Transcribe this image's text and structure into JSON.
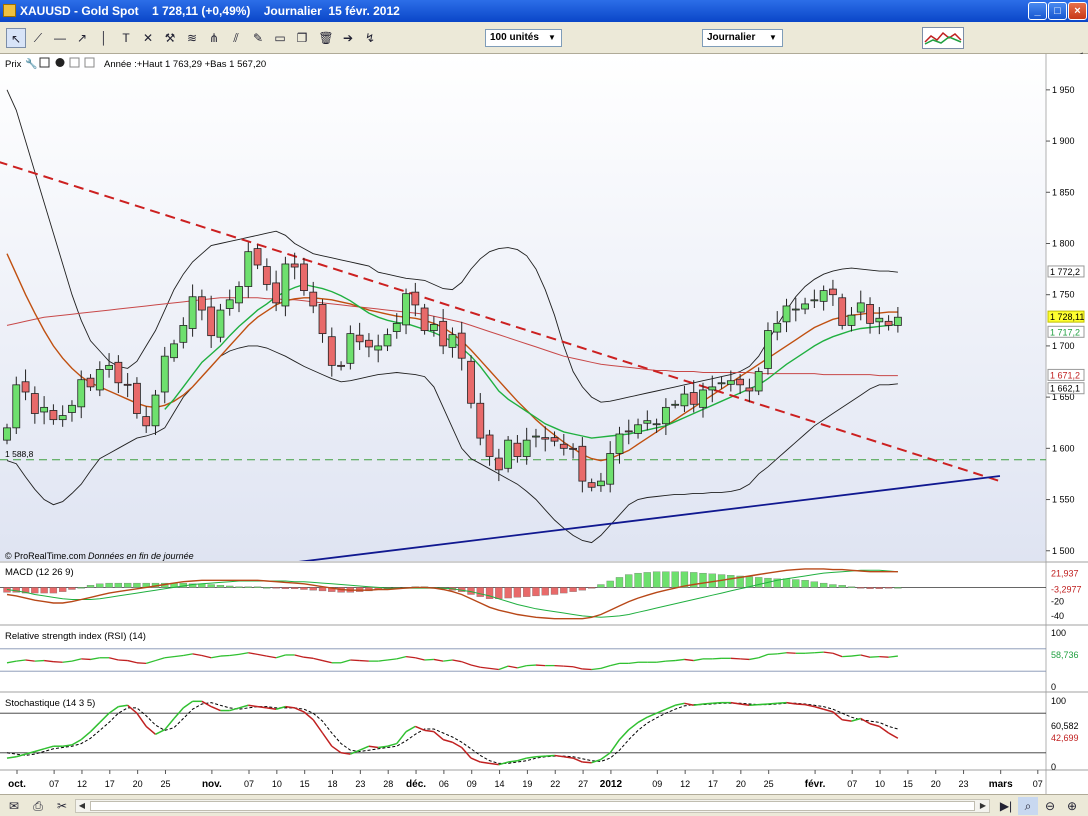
{
  "window": {
    "title": "XAUUSD - Gold Spot    1 728,11 (+0,49%)    Journalier  15 févr. 2012",
    "buttons": [
      "_",
      "□",
      "×"
    ]
  },
  "toolbar": {
    "icons": [
      "cursor-icon",
      "line-icon",
      "h-line-icon",
      "trend-line-icon",
      "v-line-icon",
      "text-icon",
      "cross-icon",
      "tools-icon",
      "fibonacci-icon",
      "pitchfork-icon",
      "edit-icon",
      "rectangle-icon",
      "copy-icon",
      "trash-icon",
      "arrow-right-icon",
      "indicator-icon"
    ],
    "units_select": "100 unités",
    "period_select": "Journalier"
  },
  "panels": {
    "price": {
      "label": "Prix",
      "info": "Année :+Haut 1 763,29 +Bas 1 567,20"
    },
    "macd": {
      "label": "MACD (12 26 9)"
    },
    "rsi": {
      "label": "Relative strength index (RSI) (14)"
    },
    "stoch": {
      "label": "Stochastique (14 3 5)"
    }
  },
  "watermark": {
    "brand": "© ProRealTime.com",
    "note": "Données en fin de journée"
  },
  "colors": {
    "up": "#6ee06e",
    "down": "#e86a6a",
    "background_top": "#ffffff",
    "background_bottom": "#dfe4f2",
    "resistance": "#cc2020",
    "support": "#101890",
    "bollinger": "#202020",
    "ma_short": "#20b040",
    "ma_long": "#c84848"
  },
  "chart_data": {
    "type": "candlestick",
    "price_axis": {
      "ticks": [
        "1 950",
        "1 900",
        "1 850",
        "1 800",
        "1 750",
        "1 700",
        "1 650",
        "1 600",
        "1 550",
        "1 500"
      ],
      "ylim": [
        1490,
        1985
      ]
    },
    "price_labels": [
      {
        "text": "1 772,2",
        "value": 1772.2,
        "color": "#000000",
        "bg": "#ffffff"
      },
      {
        "text": "1 728,11",
        "value": 1728.11,
        "color": "#000000",
        "bg": "#ffff30"
      },
      {
        "text": "1 717,2",
        "value": 1717.2,
        "color": "#20a040",
        "bg": "#ffffff"
      },
      {
        "text": "1 671,2",
        "value": 1671.2,
        "color": "#c02020",
        "bg": "#ffffff"
      },
      {
        "text": "1 662,1",
        "value": 1662.1,
        "color": "#000000",
        "bg": "#ffffff"
      }
    ],
    "support_label": {
      "text": "1 588,8",
      "value": 1588.8
    },
    "x_labels": [
      {
        "text": "oct.",
        "i": 0,
        "bold": true
      },
      {
        "text": "07",
        "i": 4
      },
      {
        "text": "12",
        "i": 7
      },
      {
        "text": "17",
        "i": 10
      },
      {
        "text": "20",
        "i": 13
      },
      {
        "text": "25",
        "i": 16
      },
      {
        "text": "nov.",
        "i": 21,
        "bold": true
      },
      {
        "text": "07",
        "i": 25
      },
      {
        "text": "10",
        "i": 28
      },
      {
        "text": "15",
        "i": 31
      },
      {
        "text": "18",
        "i": 34
      },
      {
        "text": "23",
        "i": 37
      },
      {
        "text": "28",
        "i": 40
      },
      {
        "text": "déc.",
        "i": 43,
        "bold": true
      },
      {
        "text": "06",
        "i": 46
      },
      {
        "text": "09",
        "i": 49
      },
      {
        "text": "14",
        "i": 52
      },
      {
        "text": "19",
        "i": 55
      },
      {
        "text": "22",
        "i": 58
      },
      {
        "text": "27",
        "i": 61
      },
      {
        "text": "2012",
        "i": 64,
        "bold": true
      },
      {
        "text": "09",
        "i": 69
      },
      {
        "text": "12",
        "i": 72
      },
      {
        "text": "17",
        "i": 75
      },
      {
        "text": "20",
        "i": 78
      },
      {
        "text": "25",
        "i": 81
      },
      {
        "text": "févr.",
        "i": 86,
        "bold": true
      },
      {
        "text": "07",
        "i": 90
      },
      {
        "text": "10",
        "i": 93
      },
      {
        "text": "15",
        "i": 96
      },
      {
        "text": "20",
        "i": 99
      },
      {
        "text": "23",
        "i": 102
      },
      {
        "text": "mars",
        "i": 106,
        "bold": true
      },
      {
        "text": "07",
        "i": 110
      }
    ],
    "closes": [
      1620,
      1662,
      1655,
      1634,
      1640,
      1628,
      1632,
      1642,
      1667,
      1660,
      1677,
      1681,
      1664,
      1662,
      1634,
      1622,
      1652,
      1690,
      1702,
      1720,
      1748,
      1735,
      1710,
      1735,
      1745,
      1758,
      1792,
      1779,
      1760,
      1742,
      1780,
      1777,
      1754,
      1739,
      1712,
      1681,
      1680,
      1712,
      1704,
      1699,
      1700,
      1711,
      1722,
      1751,
      1740,
      1715,
      1721,
      1700,
      1711,
      1688,
      1644,
      1610,
      1592,
      1579,
      1608,
      1592,
      1608,
      1612,
      1609,
      1607,
      1600,
      1599,
      1568,
      1562,
      1568,
      1595,
      1614,
      1616,
      1623,
      1627,
      1624,
      1640,
      1643,
      1653,
      1643,
      1657,
      1660,
      1664,
      1666,
      1662,
      1656,
      1675,
      1715,
      1722,
      1739,
      1736,
      1741,
      1745,
      1754,
      1750,
      1720,
      1730,
      1742,
      1722,
      1727,
      1720,
      1728
    ],
    "ma_short": [
      null,
      null,
      null,
      null,
      null,
      null,
      null,
      null,
      null,
      null,
      null,
      null,
      null,
      null,
      null,
      null,
      null,
      1638,
      1648,
      1660,
      1672,
      1684,
      1692,
      1700,
      1710,
      1719,
      1727,
      1735,
      1741,
      1748,
      1753,
      1757,
      1760,
      1758,
      1756,
      1753,
      1749,
      1744,
      1738,
      1732,
      1728,
      1725,
      1723,
      1722,
      1719,
      1716,
      1713,
      1709,
      1704,
      1698,
      1690,
      1680,
      1668,
      1656,
      1648,
      1642,
      1636,
      1630,
      1624,
      1620,
      1616,
      1614,
      1612,
      1610,
      1611,
      1612,
      1613,
      1614,
      1616,
      1618,
      1620,
      1622,
      1626,
      1630,
      1634,
      1638,
      1642,
      1646,
      1650,
      1654,
      1658,
      1662,
      1668,
      1675,
      1682,
      1688,
      1694,
      1700,
      1705,
      1709,
      1712,
      1715,
      1717,
      1718,
      1719,
      1720,
      1721
    ],
    "ma_long": [
      1720,
      1722,
      1724,
      1726,
      1728,
      1729,
      1730,
      1731,
      1732,
      1733,
      1734,
      1735,
      1736,
      1737,
      1738,
      1739,
      1740,
      1741,
      1742,
      1743,
      1744,
      1745,
      1746,
      1747,
      1747,
      1747,
      1747,
      1747,
      1746,
      1746,
      1745,
      1745,
      1744,
      1743,
      1742,
      1741,
      1740,
      1739,
      1738,
      1737,
      1736,
      1735,
      1734,
      1733,
      1732,
      1731,
      1729,
      1727,
      1725,
      1723,
      1720,
      1717,
      1714,
      1711,
      1708,
      1705,
      1702,
      1699,
      1696,
      1693,
      1690,
      1688,
      1686,
      1684,
      1682,
      1681,
      1680,
      1679,
      1678,
      1677,
      1676,
      1676,
      1675,
      1675,
      1675,
      1674,
      1674,
      1674,
      1674,
      1674,
      1674,
      1673,
      1673,
      1673,
      1673,
      1673,
      1673,
      1673,
      1672,
      1672,
      1672,
      1672,
      1672,
      1672,
      1671,
      1671,
      1671
    ],
    "ma_slow": [
      1790,
      1770,
      1750,
      1732,
      1715,
      1700,
      1688,
      1678,
      1670,
      1664,
      1660,
      1656,
      1652,
      1648,
      1644,
      1641,
      1640,
      1642,
      1646,
      1652,
      1660,
      1670,
      1680,
      1690,
      1700,
      1710,
      1720,
      1728,
      1734,
      1740,
      1744,
      1746,
      1747,
      1747,
      1746,
      1745,
      1743,
      1741,
      1738,
      1735,
      1733,
      1731,
      1729,
      1728,
      1727,
      1725,
      1722,
      1718,
      1712,
      1705,
      1696,
      1686,
      1676,
      1666,
      1656,
      1646,
      1637,
      1628,
      1620,
      1613,
      1606,
      1600,
      1594,
      1590,
      1588,
      1590,
      1594,
      1598,
      1604,
      1610,
      1616,
      1622,
      1628,
      1634,
      1640,
      1646,
      1652,
      1658,
      1664,
      1670,
      1676,
      1682,
      1688,
      1694,
      1700,
      1706,
      1712,
      1718,
      1722,
      1726,
      1728,
      1730,
      1731,
      1732,
      1732,
      1733,
      1733
    ],
    "bollinger_upper": [
      1950,
      1930,
      1900,
      1870,
      1840,
      1810,
      1780,
      1750,
      1725,
      1705,
      1695,
      1685,
      1680,
      1678,
      1685,
      1700,
      1715,
      1735,
      1755,
      1770,
      1782,
      1790,
      1798,
      1800,
      1802,
      1804,
      1806,
      1808,
      1810,
      1812,
      1808,
      1800,
      1795,
      1790,
      1788,
      1786,
      1784,
      1782,
      1780,
      1778,
      1772,
      1770,
      1768,
      1766,
      1765,
      1764,
      1760,
      1756,
      1755,
      1762,
      1775,
      1785,
      1792,
      1795,
      1796,
      1794,
      1788,
      1775,
      1755,
      1730,
      1700,
      1675,
      1660,
      1650,
      1645,
      1646,
      1648,
      1650,
      1652,
      1654,
      1656,
      1658,
      1660,
      1662,
      1664,
      1666,
      1668,
      1670,
      1672,
      1675,
      1680,
      1690,
      1705,
      1720,
      1735,
      1748,
      1758,
      1765,
      1770,
      1773,
      1775,
      1776,
      1775,
      1774,
      1773,
      1773,
      1772
    ],
    "bollinger_lower": [
      1588,
      1585,
      1572,
      1560,
      1550,
      1545,
      1548,
      1556,
      1565,
      1578,
      1590,
      1595,
      1600,
      1605,
      1610,
      1612,
      1615,
      1620,
      1635,
      1650,
      1660,
      1670,
      1680,
      1690,
      1695,
      1698,
      1700,
      1700,
      1698,
      1694,
      1690,
      1685,
      1680,
      1676,
      1672,
      1668,
      1665,
      1666,
      1668,
      1670,
      1672,
      1673,
      1674,
      1673,
      1672,
      1670,
      1660,
      1640,
      1620,
      1600,
      1590,
      1585,
      1580,
      1575,
      1570,
      1565,
      1558,
      1550,
      1540,
      1530,
      1522,
      1515,
      1510,
      1508,
      1515,
      1525,
      1535,
      1545,
      1550,
      1552,
      1553,
      1554,
      1555,
      1555,
      1556,
      1556,
      1557,
      1557,
      1558,
      1560,
      1565,
      1575,
      1582,
      1590,
      1598,
      1606,
      1614,
      1622,
      1628,
      1634,
      1640,
      1646,
      1652,
      1658,
      1662,
      1662,
      1663
    ],
    "resistance_line": {
      "from": {
        "i": -1,
        "v": 1880
      },
      "to": {
        "i": 107,
        "v": 1568
      }
    },
    "support_line": {
      "from": {
        "i": 25,
        "v": 1482
      },
      "to": {
        "i": 107,
        "v": 1573
      }
    },
    "support_level": 1588.8,
    "macd": {
      "labels": [
        {
          "text": "21,937",
          "value": 21.937,
          "color": "#c02020"
        },
        {
          "text": "-3,2977",
          "value": -3.2977,
          "color": "#c02020"
        },
        {
          "text": "-20",
          "value": -20
        },
        {
          "text": "-40",
          "value": -40
        }
      ],
      "ylim": [
        -50,
        30
      ],
      "macd": [
        -10,
        -12,
        -15,
        -18,
        -20,
        -22,
        -22,
        -20,
        -17,
        -14,
        -11,
        -8,
        -6,
        -4,
        -2,
        0,
        2,
        4,
        6,
        8,
        9,
        10,
        10,
        10,
        10,
        10,
        10,
        10,
        9,
        8,
        7,
        6,
        5,
        3,
        1,
        -1,
        -3,
        -4,
        -4,
        -4,
        -3,
        -3,
        -2,
        -1,
        0,
        0,
        -1,
        -3,
        -6,
        -10,
        -16,
        -22,
        -28,
        -32,
        -35,
        -38,
        -40,
        -42,
        -43,
        -44,
        -44,
        -44,
        -44,
        -42,
        -38,
        -32,
        -26,
        -20,
        -15,
        -11,
        -7,
        -4,
        -1,
        2,
        4,
        6,
        8,
        10,
        12,
        14,
        16,
        18,
        20,
        22,
        24,
        25,
        26,
        26,
        26,
        25,
        25,
        24,
        23,
        22,
        22,
        22,
        22
      ],
      "signal": [
        -3,
        -5,
        -7,
        -10,
        -12,
        -14,
        -16,
        -17,
        -17,
        -17,
        -16,
        -14,
        -12,
        -10,
        -8,
        -6,
        -4,
        -2,
        0,
        2,
        4,
        5,
        6,
        7,
        8,
        9,
        9,
        9,
        9,
        9,
        9,
        8,
        8,
        7,
        6,
        5,
        4,
        3,
        2,
        1,
        0,
        -1,
        -1,
        -1,
        -1,
        -1,
        -1,
        -1,
        -2,
        -4,
        -6,
        -9,
        -12,
        -16,
        -20,
        -24,
        -27,
        -30,
        -32,
        -34,
        -36,
        -38,
        -40,
        -41,
        -42,
        -41,
        -40,
        -38,
        -35,
        -32,
        -29,
        -26,
        -23,
        -20,
        -17,
        -14,
        -11,
        -8,
        -5,
        -2,
        1,
        4,
        7,
        10,
        12,
        14,
        16,
        18,
        20,
        21,
        22,
        23,
        24,
        24,
        24,
        23,
        22
      ]
    },
    "rsi": {
      "labels": [
        {
          "text": "100",
          "value": 100
        },
        {
          "text": "58,736",
          "value": 58.736,
          "color": "#20a040"
        },
        {
          "text": "0",
          "value": 0
        }
      ],
      "ylim": [
        0,
        100
      ],
      "levels": [
        70,
        30
      ],
      "values": [
        45,
        48,
        50,
        48,
        49,
        47,
        46,
        48,
        52,
        51,
        54,
        54,
        50,
        49,
        45,
        44,
        49,
        54,
        56,
        58,
        61,
        58,
        54,
        57,
        58,
        60,
        63,
        60,
        57,
        54,
        59,
        59,
        55,
        53,
        49,
        45,
        45,
        50,
        49,
        48,
        48,
        50,
        52,
        56,
        54,
        50,
        51,
        48,
        50,
        47,
        41,
        37,
        35,
        33,
        39,
        36,
        40,
        41,
        40,
        40,
        39,
        38,
        34,
        33,
        35,
        40,
        44,
        44,
        46,
        46,
        46,
        48,
        49,
        51,
        49,
        52,
        52,
        53,
        53,
        52,
        51,
        54,
        60,
        61,
        63,
        62,
        62,
        63,
        64,
        62,
        56,
        57,
        59,
        55,
        56,
        55,
        57
      ]
    },
    "stoch": {
      "labels": [
        {
          "text": "100",
          "value": 100
        },
        {
          "text": "60,582",
          "value": 60.582,
          "color": "#000000"
        },
        {
          "text": "42,699",
          "value": 42.699,
          "color": "#c02020"
        },
        {
          "text": "0",
          "value": 0
        }
      ],
      "ylim": [
        0,
        100
      ],
      "levels": [
        80,
        20
      ],
      "k": [
        12,
        14,
        18,
        22,
        26,
        30,
        30,
        32,
        40,
        52,
        66,
        80,
        90,
        92,
        80,
        60,
        48,
        55,
        72,
        88,
        98,
        98,
        90,
        84,
        84,
        88,
        92,
        90,
        88,
        86,
        90,
        88,
        82,
        70,
        50,
        30,
        20,
        18,
        24,
        30,
        28,
        30,
        34,
        52,
        60,
        54,
        52,
        40,
        36,
        28,
        12,
        6,
        4,
        2,
        6,
        8,
        12,
        14,
        15,
        16,
        14,
        12,
        6,
        5,
        10,
        20,
        40,
        55,
        66,
        74,
        80,
        86,
        92,
        95,
        92,
        94,
        95,
        96,
        96,
        94,
        92,
        93,
        94,
        95,
        96,
        94,
        93,
        90,
        86,
        82,
        70,
        68,
        72,
        64,
        60,
        50,
        42
      ],
      "d": [
        20,
        18,
        16,
        18,
        22,
        26,
        28,
        30,
        34,
        42,
        54,
        66,
        80,
        88,
        88,
        76,
        62,
        54,
        58,
        72,
        86,
        94,
        96,
        92,
        88,
        86,
        88,
        90,
        90,
        88,
        88,
        88,
        86,
        80,
        68,
        50,
        34,
        24,
        22,
        24,
        26,
        28,
        30,
        38,
        48,
        56,
        56,
        50,
        44,
        36,
        26,
        16,
        8,
        4,
        4,
        6,
        8,
        12,
        14,
        15,
        15,
        14,
        11,
        8,
        7,
        12,
        24,
        40,
        54,
        65,
        73,
        80,
        86,
        91,
        93,
        93,
        94,
        95,
        95,
        95,
        94,
        93,
        93,
        94,
        95,
        95,
        94,
        92,
        90,
        86,
        80,
        74,
        70,
        68,
        66,
        60,
        56
      ]
    }
  },
  "statusbar": {
    "icons": [
      "mail-icon",
      "print-icon",
      "cut-icon",
      "scroll-left-icon",
      "scroll-right-icon",
      "zoom-fit-icon",
      "zoom-out-icon",
      "zoom-in-icon"
    ]
  }
}
